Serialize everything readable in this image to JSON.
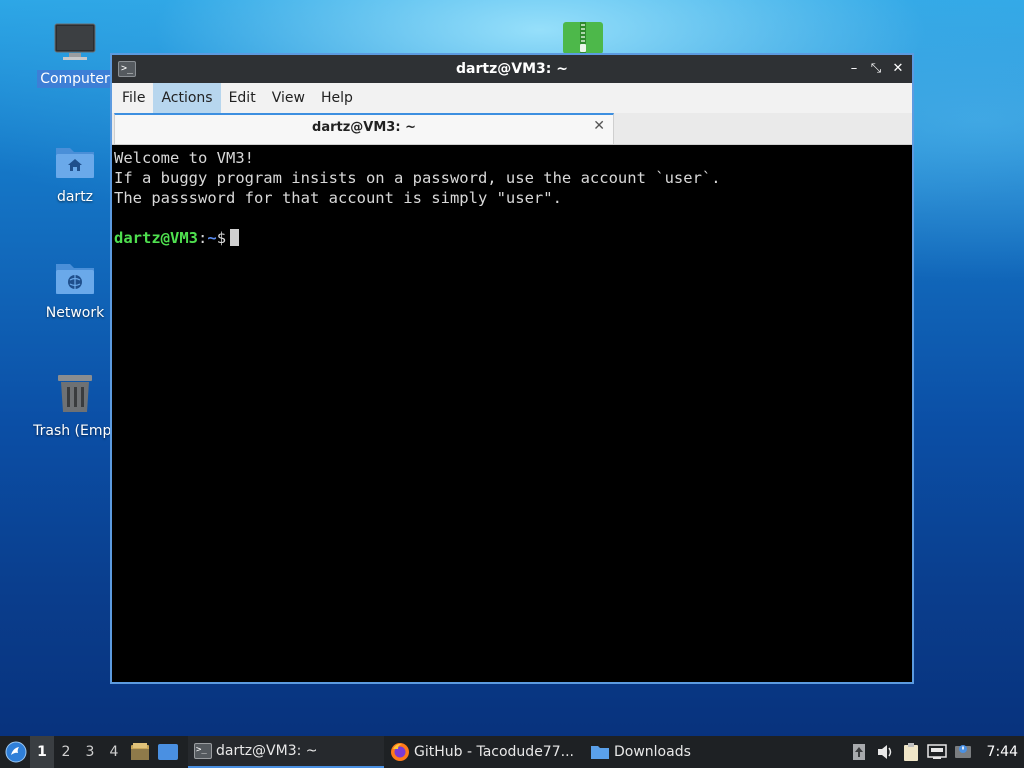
{
  "desktop": {
    "icons": [
      {
        "label": "Computer"
      },
      {
        "label": "dartz"
      },
      {
        "label": "Network"
      },
      {
        "label": "Trash (Empt"
      }
    ]
  },
  "window": {
    "title": "dartz@VM3: ~",
    "menu": [
      "File",
      "Actions",
      "Edit",
      "View",
      "Help"
    ],
    "tab": {
      "title": "dartz@VM3: ~"
    },
    "terminal": {
      "lines": [
        "Welcome to VM3!",
        "If a buggy program insists on a password, use the account `user`.",
        "The passsword for that account is simply \"user\"."
      ],
      "prompt_user": "dartz@VM3",
      "prompt_sep": ":",
      "prompt_path": "~",
      "prompt_sym": "$"
    }
  },
  "taskbar": {
    "workspaces": [
      "1",
      "2",
      "3",
      "4"
    ],
    "tasks": [
      {
        "label": "dartz@VM3: ~"
      },
      {
        "label": "GitHub - Tacodude77..."
      },
      {
        "label": "Downloads"
      }
    ],
    "clock": "7:44"
  }
}
